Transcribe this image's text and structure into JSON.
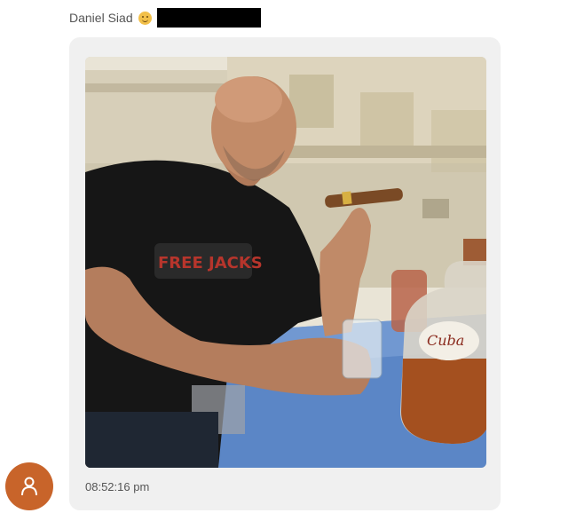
{
  "message": {
    "sender_name": "Daniel Siad",
    "emoji_icon": "smiling-face-emoji-icon",
    "redacted_field": "redacted",
    "timestamp": "08:52:16 pm",
    "attachment_type": "photo",
    "avatar_icon": "user-icon"
  },
  "colors": {
    "bubble_bg": "#f0f0f0",
    "avatar_bg": "#c8642a",
    "text": "#555555"
  }
}
